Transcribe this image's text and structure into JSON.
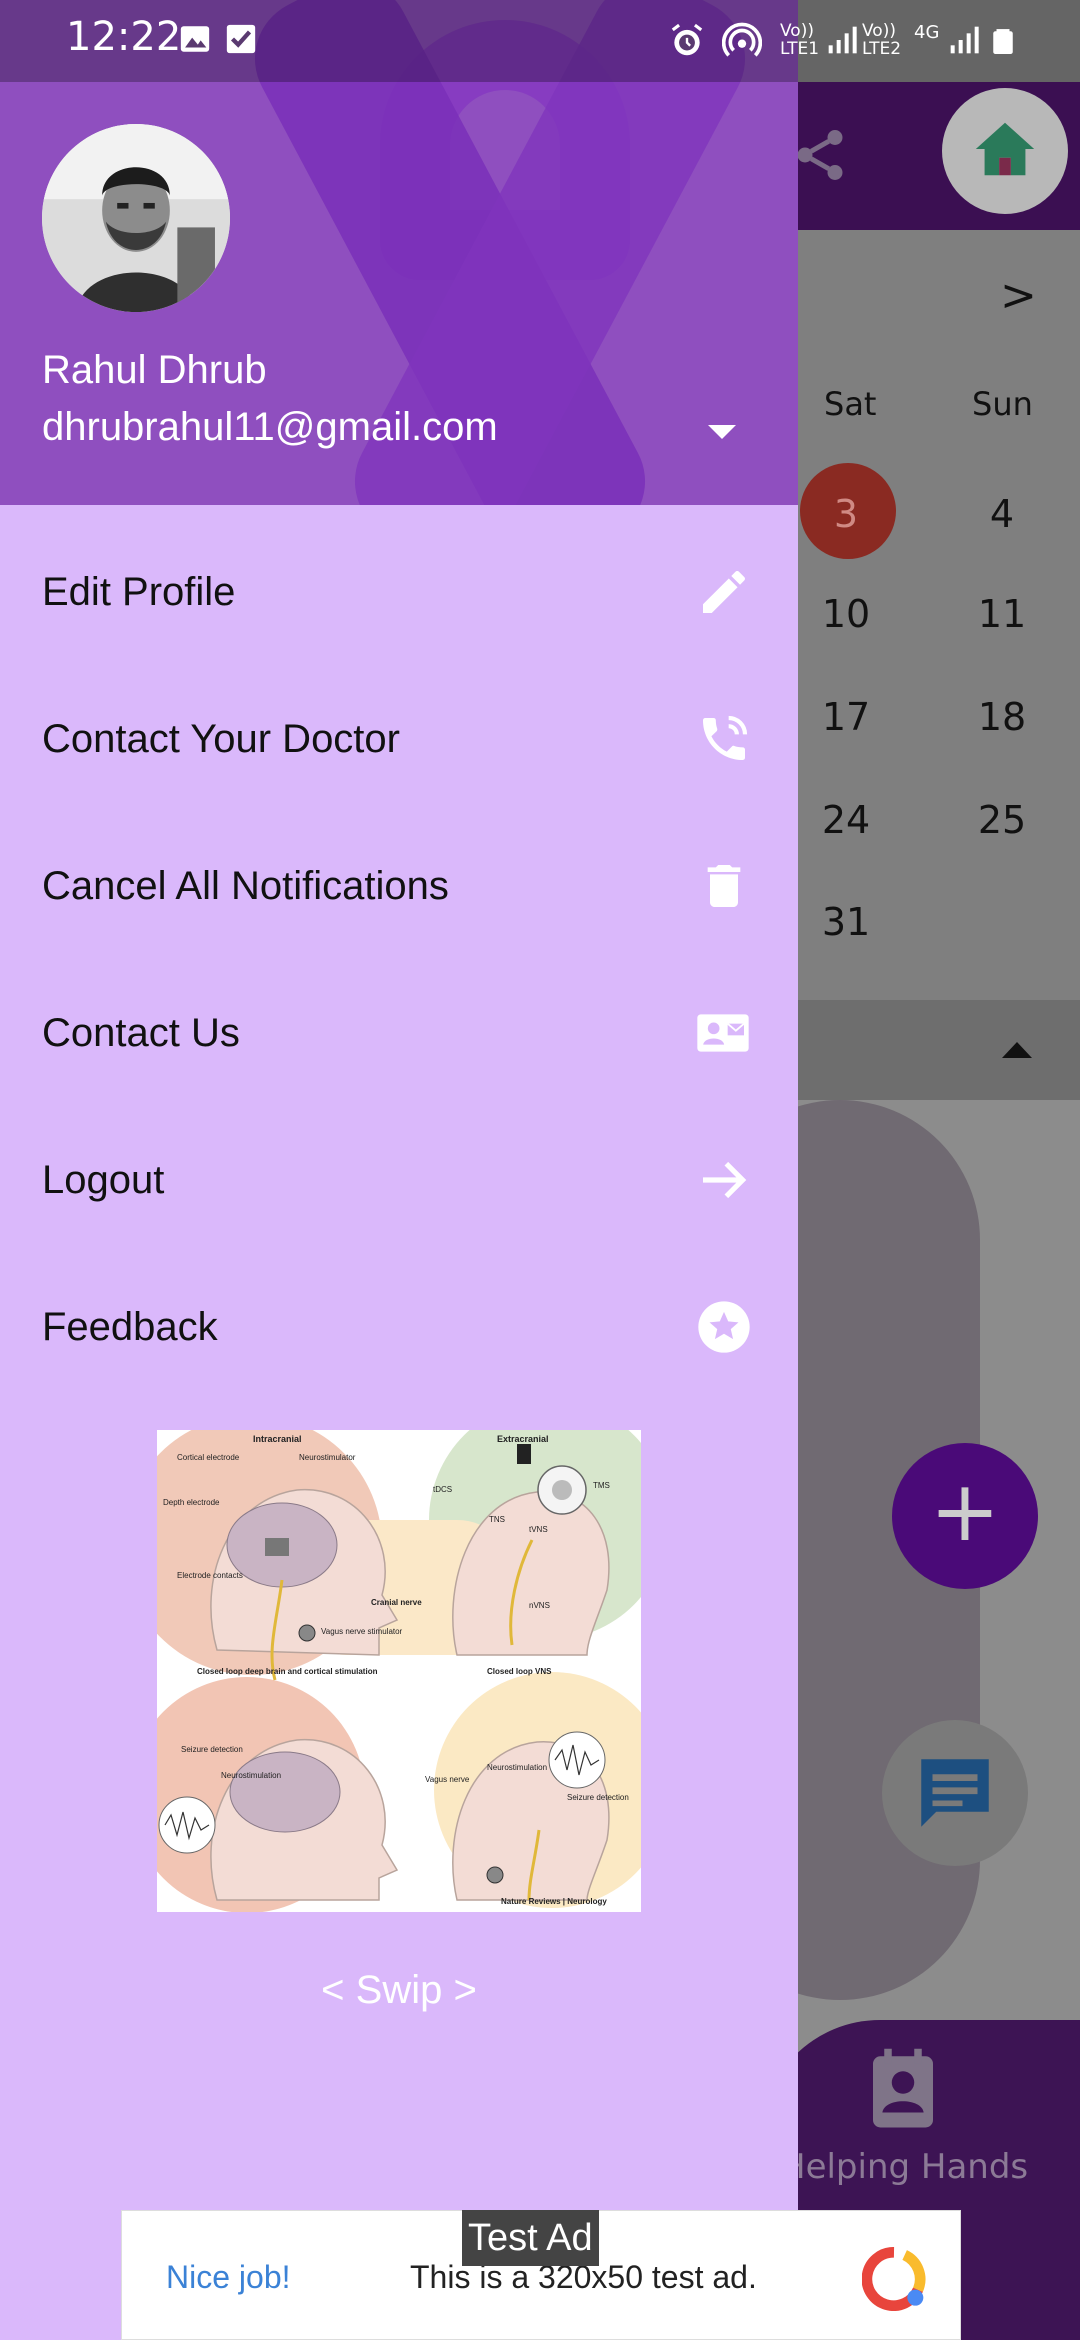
{
  "status_bar": {
    "time": "12:22",
    "sim1_label": "Vo)) LTE1",
    "sim2_label": "Vo)) LTE2",
    "network_type": "4G"
  },
  "drawer": {
    "user": {
      "name": "Rahul Dhrub",
      "email": "dhrubrahul11@gmail.com"
    },
    "menu": [
      {
        "label": "Edit Profile",
        "icon": "pencil-icon"
      },
      {
        "label": "Contact Your Doctor",
        "icon": "phone-call-icon"
      },
      {
        "label": "Cancel All Notifications",
        "icon": "trash-icon"
      },
      {
        "label": "Contact Us",
        "icon": "contact-card-icon"
      },
      {
        "label": "Logout",
        "icon": "arrow-right-icon"
      },
      {
        "label": "Feedback",
        "icon": "star-circle-icon"
      }
    ],
    "swip_label": "< Swip >",
    "figure": {
      "labels": {
        "intracranial": "Intracranial",
        "extracranial": "Extracranial",
        "cortical_electrode": "Cortical electrode",
        "neurostimulator": "Neurostimulator",
        "depth_electrode": "Depth electrode",
        "electrode_contacts": "Electrode contacts",
        "cranial_nerve": "Cranial nerve",
        "vagus_nerve_stimulator": "Vagus nerve stimulator",
        "tdcs": "tDCS",
        "tms": "TMS",
        "tns": "TNS",
        "tvns": "tVNS",
        "nvns": "nVNS",
        "closed_loop_dbs": "Closed loop deep brain and cortical stimulation",
        "closed_loop_vns": "Closed loop VNS",
        "seizure_detection": "Seizure detection",
        "neurostimulation": "Neurostimulation",
        "vagus_nerve": "Vagus nerve",
        "credit": "Nature Reviews | Neurology"
      }
    }
  },
  "background": {
    "calendar": {
      "day_headers": [
        "Sat",
        "Sun"
      ],
      "rows": [
        [
          "3",
          "4"
        ],
        [
          "10",
          "11"
        ],
        [
          "17",
          "18"
        ],
        [
          "24",
          "25"
        ],
        [
          "31",
          ""
        ]
      ],
      "today": "3"
    },
    "bottom_nav_label": "Helping Hands",
    "fab_label": "+"
  },
  "ad": {
    "badge": "Test Ad",
    "headline": "Nice job!",
    "body": "This is a 320x50 test ad."
  },
  "colors": {
    "drawer_bg": "#dab8fb",
    "header_bg": "#8f4fbf",
    "app_bar": "#3b0f52",
    "fab": "#4a0a78"
  }
}
